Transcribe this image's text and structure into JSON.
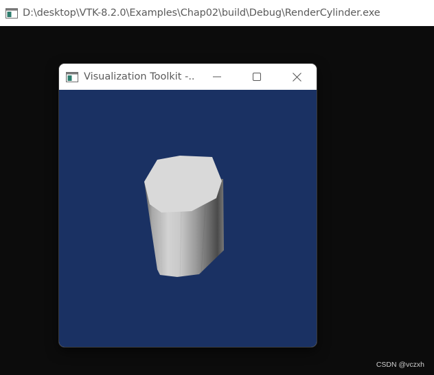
{
  "console_window": {
    "title": "D:\\desktop\\VTK-8.2.0\\Examples\\Chap02\\build\\Debug\\RenderCylinder.exe",
    "icon": "console-app-icon"
  },
  "vtk_window": {
    "title": "Visualization Toolkit -...",
    "icon": "vtk-app-icon",
    "controls": {
      "minimize": "minimize-icon",
      "maximize": "maximize-icon",
      "close": "close-icon"
    },
    "render_background": "#1a3163",
    "object": "cylinder"
  },
  "watermark": "CSDN @vczxh",
  "colors": {
    "desktop_background": "#0c0c0c",
    "titlebar_background": "#ffffff",
    "title_text": "#5a5a5a",
    "render_background": "#1a3163",
    "cylinder_cap": "#d9d9d9",
    "cylinder_side_light": "#cdcdcd",
    "cylinder_side_dark": "#4a4a4a"
  }
}
